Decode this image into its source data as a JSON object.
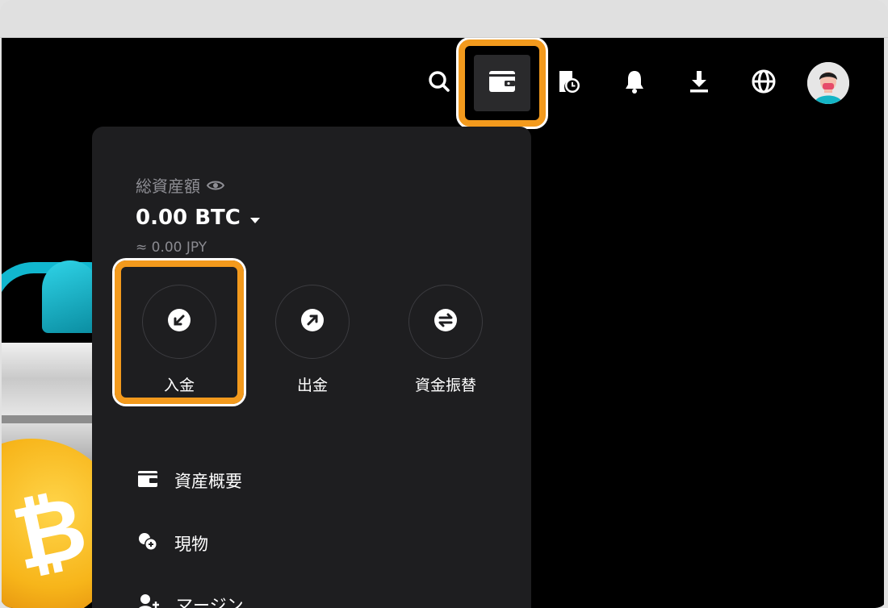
{
  "colors": {
    "highlight": "#f39a1d",
    "panel_bg": "#1e1e20",
    "app_bg": "#000000",
    "text_primary": "#ffffff",
    "text_secondary": "#8f8f95"
  },
  "header": {
    "icons": [
      "search-icon",
      "wallet-icon",
      "order-history-icon",
      "bell-icon",
      "download-icon",
      "globe-icon",
      "avatar"
    ]
  },
  "wallet_panel": {
    "total_label": "総資産額",
    "balance": "0.00 BTC",
    "balance_jpy": "≈ 0.00 JPY",
    "actions": [
      {
        "label": "入金",
        "icon": "deposit-arrow-icon"
      },
      {
        "label": "出金",
        "icon": "withdraw-arrow-icon"
      },
      {
        "label": "資金振替",
        "icon": "transfer-icon"
      }
    ],
    "menu": [
      {
        "label": "資産概要",
        "icon": "wallet-icon"
      },
      {
        "label": "現物",
        "icon": "spot-coins-icon"
      },
      {
        "label": "マージン",
        "icon": "margin-user-icon"
      }
    ]
  }
}
